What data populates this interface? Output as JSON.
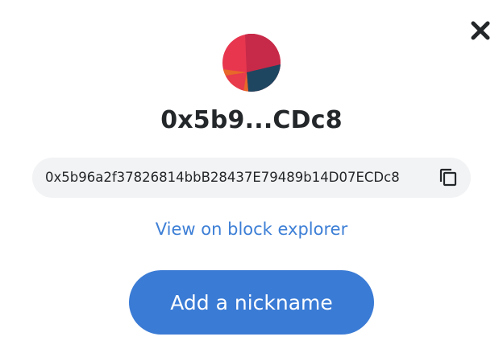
{
  "account": {
    "short_address": "0x5b9...CDc8",
    "full_address": "0x5b96a2f37826814bbB28437E79489b14D07ECDc8",
    "avatar_colors": [
      "#e8364f",
      "#c72a48",
      "#1f4660",
      "#e8672a"
    ]
  },
  "actions": {
    "explorer_link": "View on block explorer",
    "nickname_button": "Add a nickname"
  },
  "icons": {
    "close": "close-icon",
    "copy": "copy-icon",
    "avatar": "jazzicon-avatar"
  },
  "colors": {
    "link": "#3d7fd6",
    "primary_button": "#3a7bd5",
    "pill_background": "#f2f3f4",
    "text": "#24272a"
  }
}
